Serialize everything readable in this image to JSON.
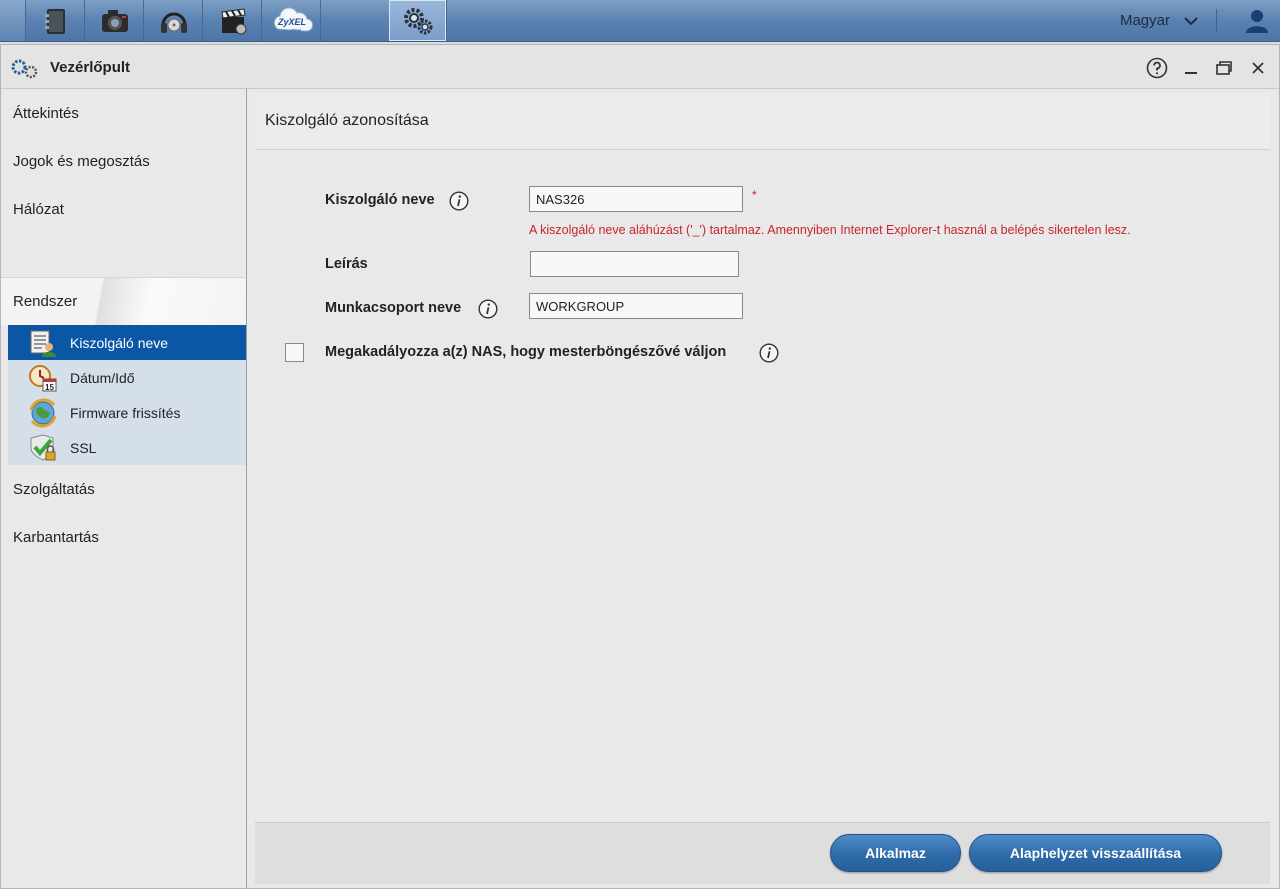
{
  "topbar": {
    "apps": [
      {
        "name": "file-browser-app",
        "icon": "phone-book-icon"
      },
      {
        "name": "photo-app",
        "icon": "camera-icon"
      },
      {
        "name": "music-app",
        "icon": "headphones-icon"
      },
      {
        "name": "video-app",
        "icon": "film-clapper-icon"
      },
      {
        "name": "zyxel-cloud-app",
        "icon": "zyxel-cloud-icon",
        "text": "ZyXEL",
        "subtext": "cloud"
      },
      {
        "name": "control-panel-app",
        "icon": "gears-icon"
      }
    ],
    "language": "Magyar"
  },
  "window": {
    "title": "Vezérlőpult"
  },
  "sidebar": {
    "items": [
      {
        "label": "Áttekintés"
      },
      {
        "label": "Jogok és megosztás"
      },
      {
        "label": "Hálózat"
      },
      {
        "label": "Rendszer"
      },
      {
        "label": "Szolgáltatás"
      },
      {
        "label": "Karbantartás"
      }
    ],
    "sub_items": [
      {
        "label": "Kiszolgáló neve",
        "icon": "server-name-icon"
      },
      {
        "label": "Dátum/Idő",
        "icon": "calendar-clock-icon",
        "badge": "15"
      },
      {
        "label": "Firmware frissítés",
        "icon": "firmware-update-icon"
      },
      {
        "label": "SSL",
        "icon": "ssl-shield-icon"
      }
    ]
  },
  "content": {
    "section_title": "Kiszolgáló azonosítása",
    "server_name": {
      "label": "Kiszolgáló neve",
      "value": "NAS326",
      "required_mark": "*"
    },
    "warning": "A kiszolgáló neve aláhúzást ('_') tartalmaz. Amennyiben Internet Explorer-t használ a belépés sikertelen lesz.",
    "description": {
      "label": "Leírás",
      "value": ""
    },
    "workgroup": {
      "label": "Munkacsoport neve",
      "value": "WORKGROUP"
    },
    "master_browser": {
      "label": "Megakadályozza a(z) NAS, hogy mesterböngészővé váljon",
      "checked": false
    }
  },
  "footer": {
    "apply_label": "Alkalmaz",
    "reset_label": "Alaphelyzet visszaállítása"
  },
  "colors": {
    "accent": "#0b57a6",
    "warning": "#c9232f",
    "button": "#2f6ba8"
  }
}
